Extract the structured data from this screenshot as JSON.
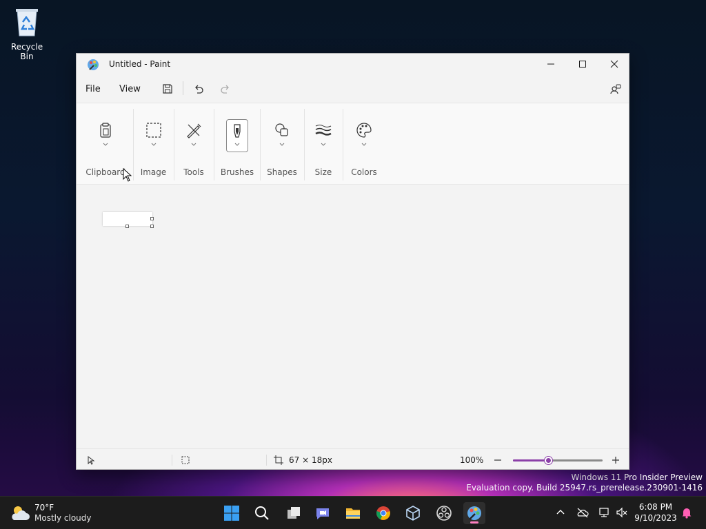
{
  "desktop": {
    "recycle_bin_label": "Recycle Bin",
    "watermark_line1": "Windows 11 Pro Insider Preview",
    "watermark_line2": "Evaluation copy. Build 25947.rs_prerelease.230901-1416"
  },
  "window": {
    "title": "Untitled - Paint",
    "icons": [
      "paint-app-icon",
      "minimize-icon",
      "maximize-icon",
      "close-icon"
    ]
  },
  "menubar": {
    "file": "File",
    "view": "View",
    "icons": [
      "save-icon",
      "undo-icon",
      "redo-icon",
      "account-icon"
    ]
  },
  "ribbon": {
    "groups": [
      {
        "label": "Clipboard",
        "icon": "clipboard-icon"
      },
      {
        "label": "Image",
        "icon": "selection-icon"
      },
      {
        "label": "Tools",
        "icon": "tools-icon"
      },
      {
        "label": "Brushes",
        "icon": "brush-icon"
      },
      {
        "label": "Shapes",
        "icon": "shapes-icon"
      },
      {
        "label": "Size",
        "icon": "size-icon"
      },
      {
        "label": "Colors",
        "icon": "palette-icon"
      }
    ]
  },
  "statusbar": {
    "canvas_size": "67 × 18px",
    "zoom": "100%",
    "zoom_fraction": 0.4
  },
  "taskbar": {
    "weather_temp": "70°F",
    "weather_condition": "Mostly cloudy",
    "time": "6:08 PM",
    "date": "9/10/2023",
    "apps": [
      "start-icon",
      "search-icon",
      "task-view-icon",
      "chat-icon",
      "file-explorer-icon",
      "chrome-icon",
      "virtualbox-icon",
      "obs-icon",
      "paint-icon"
    ]
  },
  "colors": {
    "accent": "#8b3fa8",
    "taskbar": "#1c1c1c",
    "window": "#f3f3f3"
  }
}
